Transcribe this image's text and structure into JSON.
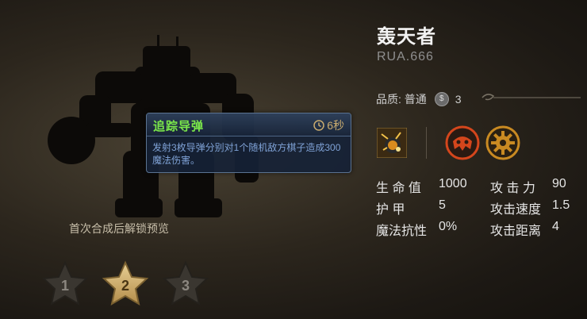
{
  "unit": {
    "name": "轰天者",
    "code": "RUA.666"
  },
  "quality": {
    "label": "品质: 普通",
    "coin_symbol": "$",
    "cost": "3"
  },
  "tooltip": {
    "title": "追踪导弹",
    "time": "6秒",
    "description": "发射3枚导弹分别对1个随机敌方棋子造成300魔法伤害。"
  },
  "unlock_text": "首次合成后解锁预览",
  "stars": [
    {
      "label": "1",
      "selected": false
    },
    {
      "label": "2",
      "selected": true
    },
    {
      "label": "3",
      "selected": false
    }
  ],
  "stats": {
    "hp_label": "生 命 值",
    "hp_value": "1000",
    "armor_label": "护        甲",
    "armor_value": "5",
    "mr_label": "魔法抗性",
    "mr_value": "0%",
    "atk_label": "攻 击 力",
    "atk_value": "90",
    "atkspd_label": "攻击速度",
    "atkspd_value": "1.5",
    "range_label": "攻击距离",
    "range_value": "4"
  },
  "icons": {
    "skill": "missile-bomb-icon",
    "race": "mech-helmet-icon",
    "class": "gear-icon",
    "clock": "clock-icon"
  },
  "colors": {
    "tooltip_title": "#7be84a",
    "tooltip_desc": "#7fa2d6",
    "race_icon": "#d4461c",
    "class_icon": "#c98a22"
  }
}
